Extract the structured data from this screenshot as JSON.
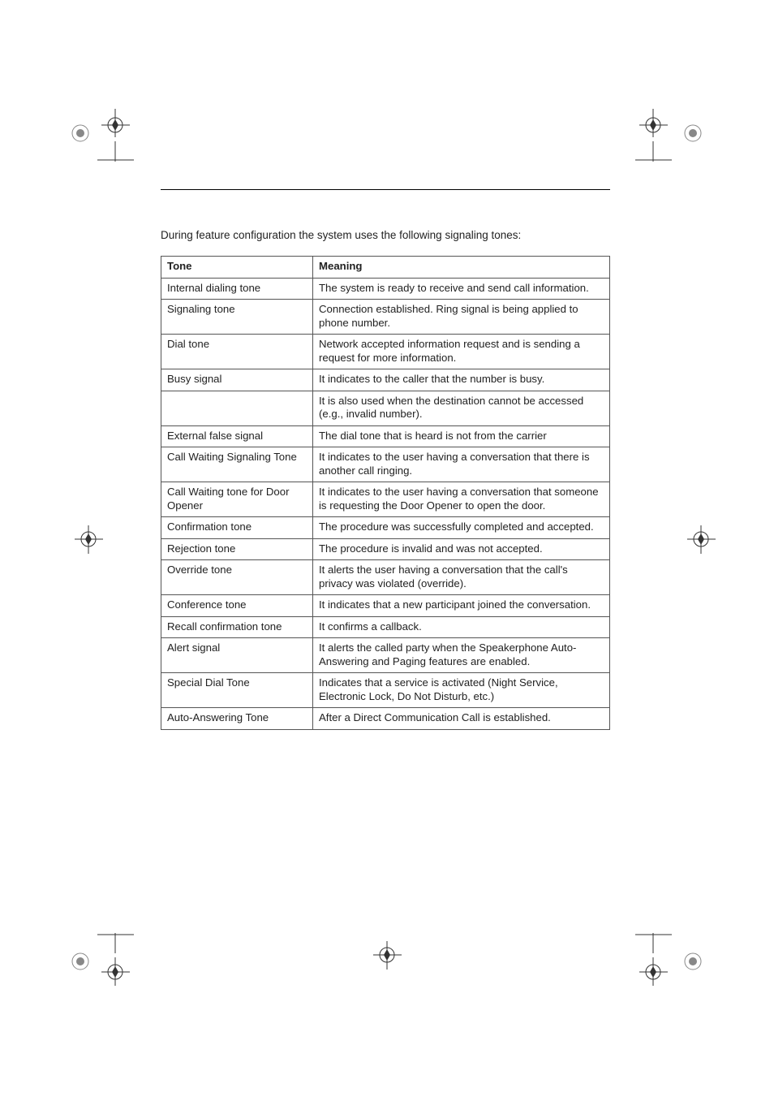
{
  "intro": "During feature configuration the system uses the following signaling tones:",
  "headers": {
    "tone": "Tone",
    "meaning": "Meaning"
  },
  "rows": [
    {
      "tone": "Internal dialing tone",
      "meaning": "The system is ready to receive and send call information."
    },
    {
      "tone": "Signaling tone",
      "meaning": "Connection established. Ring signal is being applied to phone number."
    },
    {
      "tone": "Dial tone",
      "meaning": "Network accepted information request and is sending a request for more information."
    },
    {
      "tone": "Busy signal",
      "meaning": "It indicates to the caller that the number is busy."
    },
    {
      "tone": "",
      "meaning": "It is also used when the destination cannot be accessed (e.g., invalid number)."
    },
    {
      "tone": "External false signal",
      "meaning": "The dial tone that is heard is not from the carrier"
    },
    {
      "tone": "Call Waiting Signaling Tone",
      "meaning": "It indicates to the user having a conversation that there is another call ringing."
    },
    {
      "tone": "Call Waiting tone for Door Opener",
      "meaning": "It indicates to the user having a conversation that someone is requesting the Door Opener to open the door."
    },
    {
      "tone": "Confirmation tone",
      "meaning": "The procedure was successfully completed and accepted."
    },
    {
      "tone": "Rejection tone",
      "meaning": "The procedure is invalid and was not accepted."
    },
    {
      "tone": "Override tone",
      "meaning": "It alerts the user having a conversation that the call's privacy was violated (override)."
    },
    {
      "tone": "Conference tone",
      "meaning": "It indicates that a new participant joined the conversation."
    },
    {
      "tone": "Recall confirmation tone",
      "meaning": "It confirms a callback."
    },
    {
      "tone": "Alert signal",
      "meaning": "It alerts the called party when the Speakerphone Auto-Answering and Paging features are enabled."
    },
    {
      "tone": "Special Dial Tone",
      "meaning": "Indicates that a service is activated (Night Service, Electronic Lock, Do Not Disturb, etc.)"
    },
    {
      "tone": "Auto-Answering Tone",
      "meaning": "After a Direct Communication Call is established."
    }
  ]
}
